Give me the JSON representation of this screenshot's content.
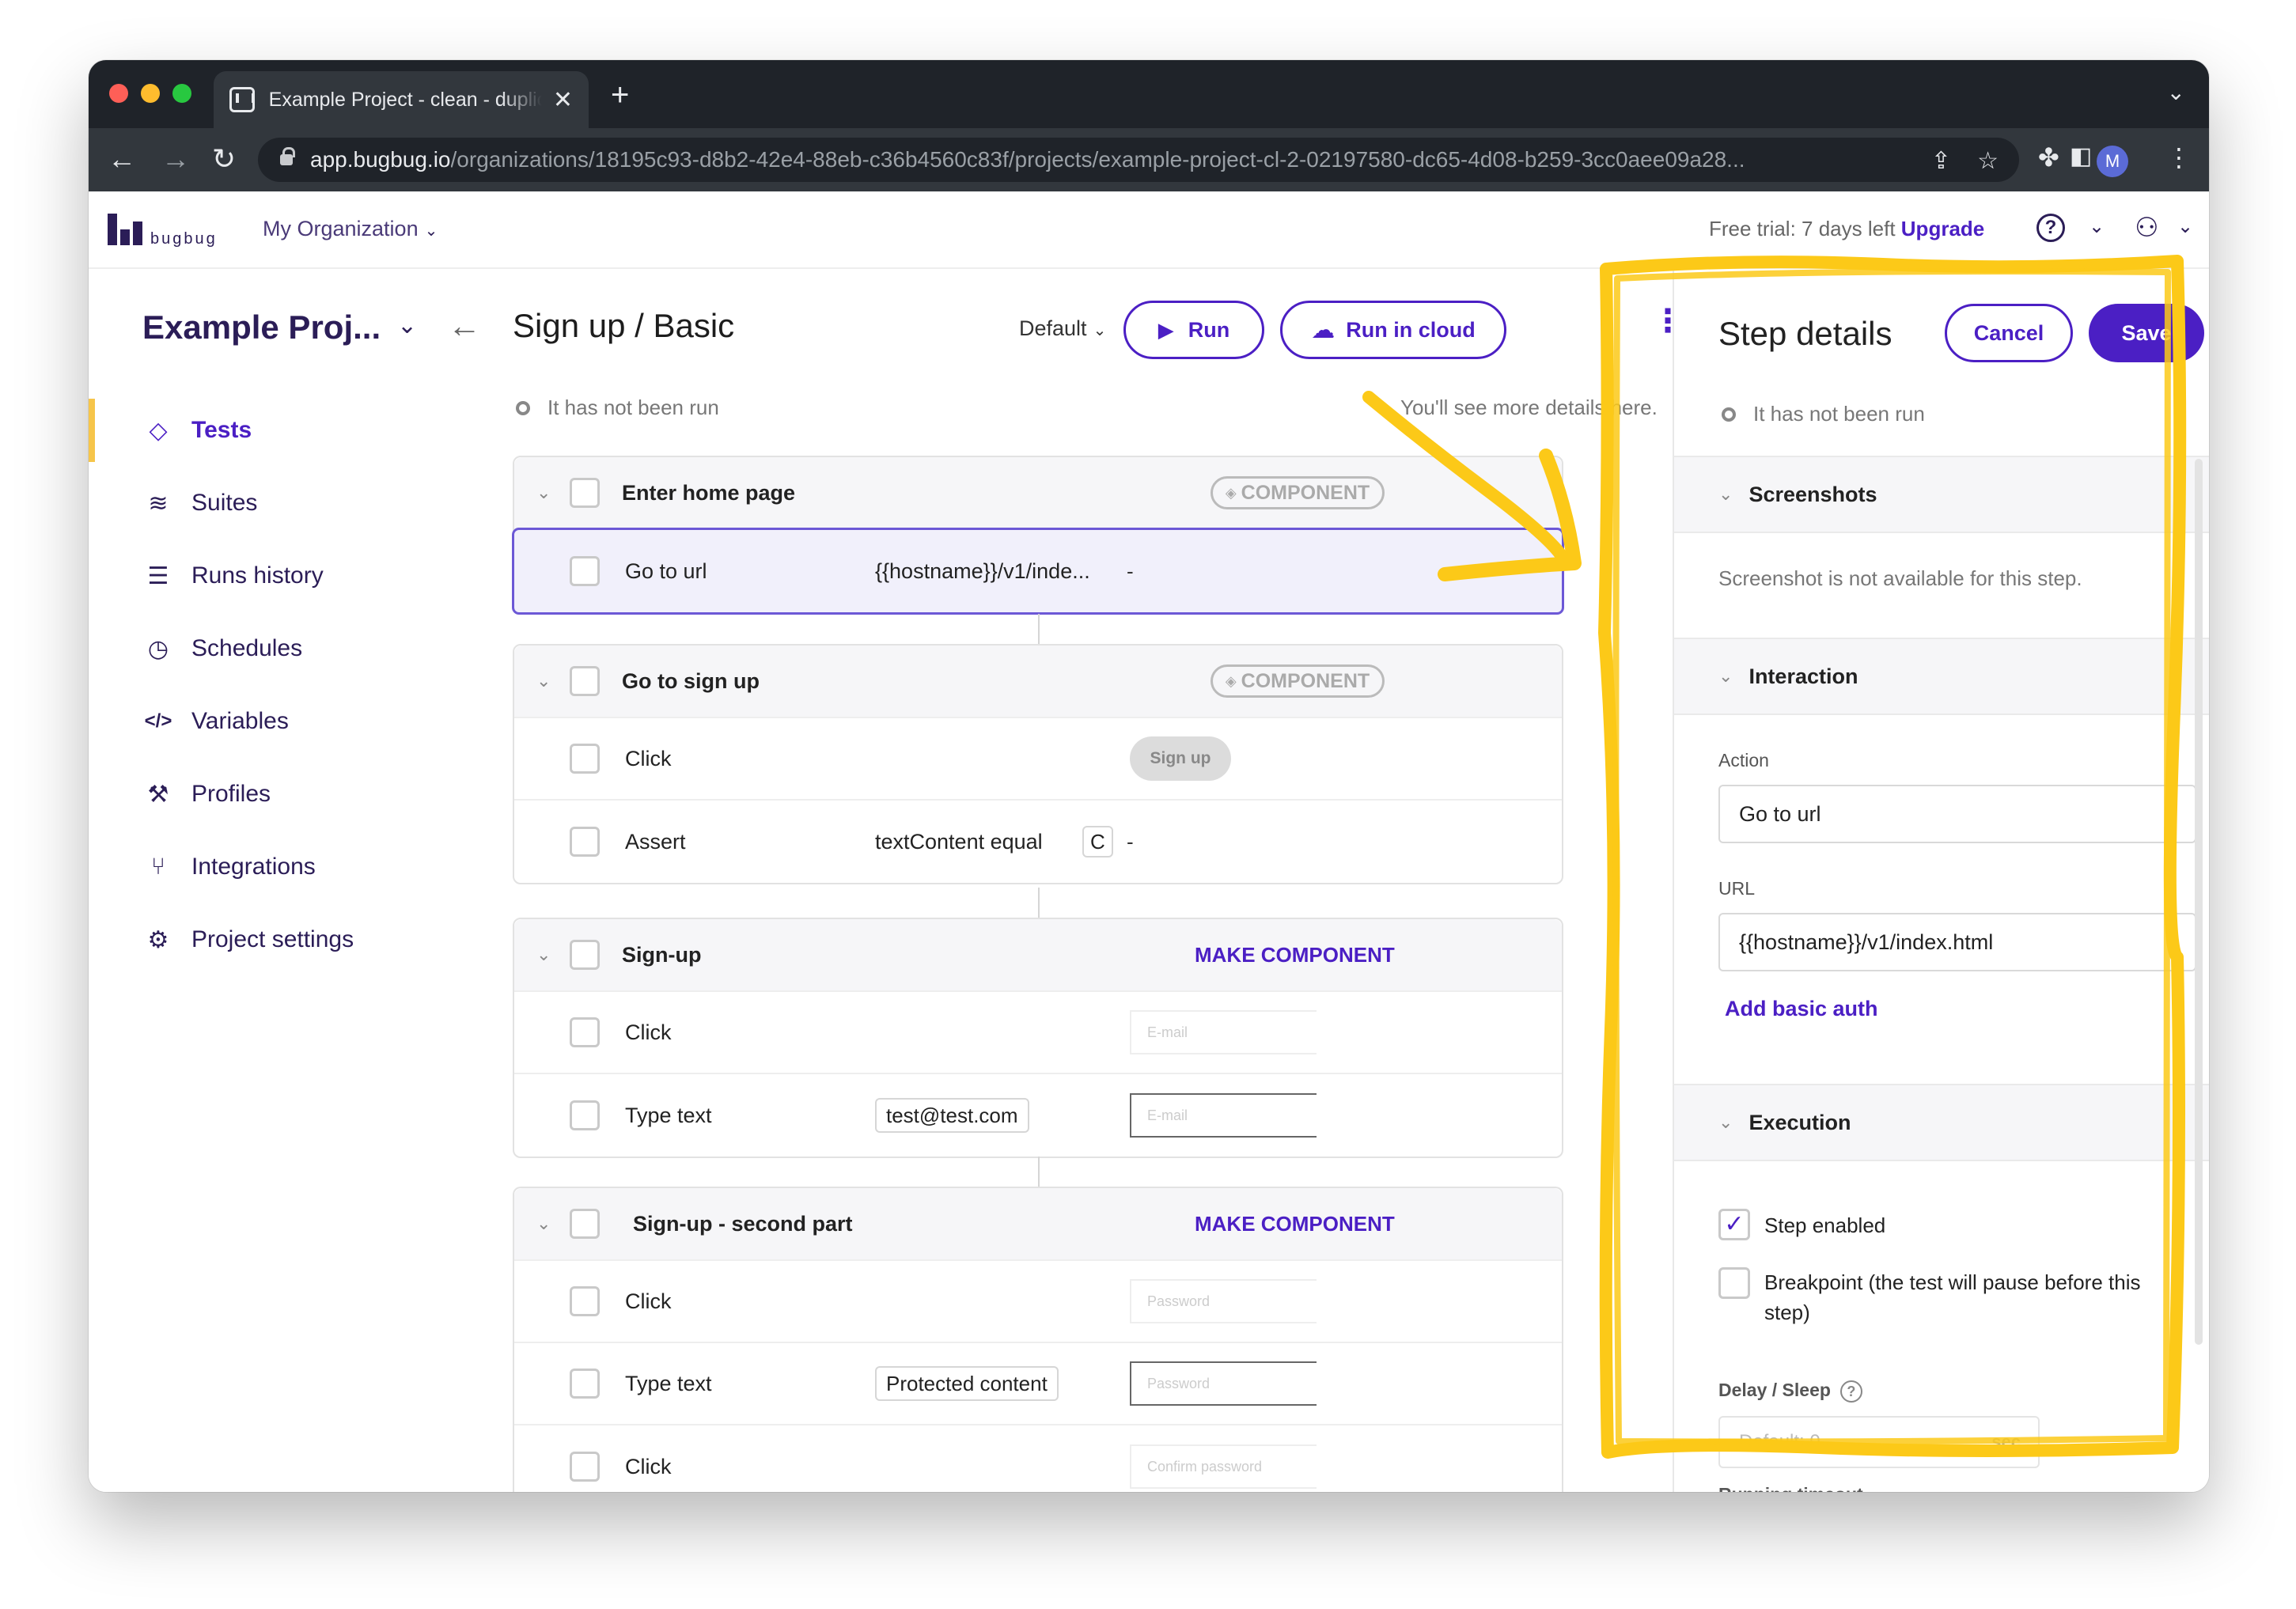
{
  "browser": {
    "tab_title": "Example Project - clean - duplicate",
    "url_host": "app.bugbug.io",
    "url_path": "/organizations/18195c93-d8b2-42e4-88eb-c36b4560c83f/projects/example-project-cl-2-02197580-dc65-4d08-b259-3cc0aee09a28...",
    "profile_initial": "M"
  },
  "header": {
    "logo_text": "bugbug",
    "org_name": "My Organization",
    "trial_text": "Free trial: 7 days left",
    "upgrade_label": "Upgrade"
  },
  "sidebar": {
    "project_name": "Example Proj...",
    "items": [
      {
        "label": "Tests",
        "icon": "diamond-icon",
        "active": true
      },
      {
        "label": "Suites",
        "icon": "layers-icon",
        "active": false
      },
      {
        "label": "Runs history",
        "icon": "list-check-icon",
        "active": false
      },
      {
        "label": "Schedules",
        "icon": "clock-history-icon",
        "active": false
      },
      {
        "label": "Variables",
        "icon": "code-icon",
        "active": false
      },
      {
        "label": "Profiles",
        "icon": "wrench-icon",
        "active": false
      },
      {
        "label": "Integrations",
        "icon": "git-icon",
        "active": false
      },
      {
        "label": "Project settings",
        "icon": "gear-icon",
        "active": false
      }
    ]
  },
  "main": {
    "title": "Sign up / Basic",
    "profile": "Default",
    "run_label": "Run",
    "run_cloud_label": "Run in cloud",
    "status": "It has not been run",
    "hint": "You'll see more details here.",
    "groups": [
      {
        "name": "Enter home page",
        "badge": "COMPONENT",
        "steps": [
          {
            "name": "Go to url",
            "param": "{{hostname}}/v1/inde...",
            "extra": "-"
          }
        ]
      },
      {
        "name": "Go to sign up",
        "badge": "COMPONENT",
        "steps": [
          {
            "name": "Click",
            "thumb": "Sign up"
          },
          {
            "name": "Assert",
            "param": "textContent equal",
            "chip": "C",
            "extra": "-"
          }
        ]
      },
      {
        "name": "Sign-up",
        "action": "MAKE COMPONENT",
        "steps": [
          {
            "name": "Click",
            "thumb": "E-mail"
          },
          {
            "name": "Type text",
            "chip": "test@test.com",
            "thumb": "E-mail"
          }
        ]
      },
      {
        "name": "Sign-up - second part",
        "action": "MAKE COMPONENT",
        "steps": [
          {
            "name": "Click",
            "thumb": "Password"
          },
          {
            "name": "Type text",
            "chip": "Protected content",
            "thumb": "Password"
          },
          {
            "name": "Click",
            "thumb": "Confirm password"
          }
        ]
      }
    ]
  },
  "panel": {
    "title": "Step details",
    "cancel_label": "Cancel",
    "save_label": "Save",
    "status": "It has not been run",
    "screenshots_title": "Screenshots",
    "screenshot_note": "Screenshot is not available for this step.",
    "interaction_title": "Interaction",
    "action_label": "Action",
    "action_value": "Go to url",
    "url_label": "URL",
    "url_value": "{{hostname}}/v1/index.html",
    "basic_auth_label": "Add basic auth",
    "execution_title": "Execution",
    "step_enabled_label": "Step enabled",
    "step_enabled": true,
    "breakpoint_label": "Breakpoint (the test will pause before this step)",
    "breakpoint": false,
    "delay_label": "Delay / Sleep",
    "delay_placeholder": "Default: 0",
    "delay_unit": "sec",
    "next_label_partial": "Running timeout"
  },
  "colors": {
    "accent": "#4b1fc4",
    "brand_dark": "#2b1d57",
    "highlight_active": "#f6c54a",
    "annotation": "#fcc918"
  }
}
